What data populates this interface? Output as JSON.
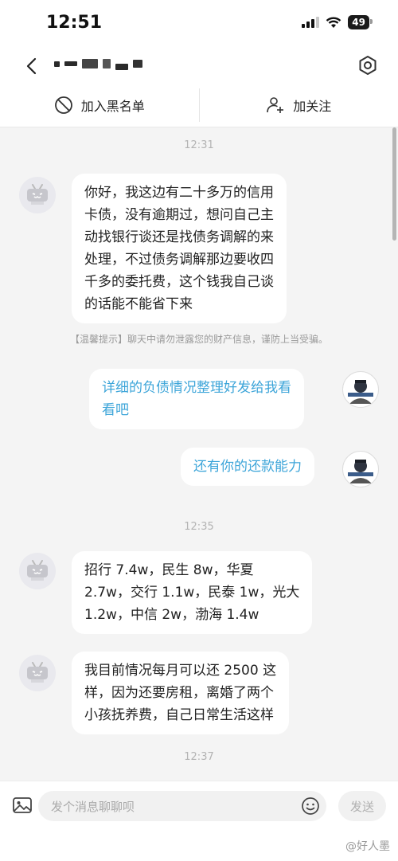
{
  "status": {
    "time": "12:51",
    "battery": "49"
  },
  "header": {
    "add_blacklist": "加入黑名单",
    "follow": "加关注"
  },
  "messages": [
    {
      "timestamp": "12:31"
    },
    {
      "side": "left",
      "text": "你好，我这边有二十多万的信用\n卡债，没有逾期过，想问自己主\n动找银行谈还是找债务调解的来\n处理，不过债务调解那边要收四\n千多的委托费，这个钱我自己谈\n的话能不能省下来"
    },
    {
      "tip": "【温馨提示】聊天中请勿泄露您的财产信息，谨防上当受骗。"
    },
    {
      "side": "right",
      "text": "详细的负债情况整理好发给我看\n看吧"
    },
    {
      "side": "right",
      "text": "还有你的还款能力"
    },
    {
      "timestamp": "12:35"
    },
    {
      "side": "left",
      "text": "招行 7.4w，民生 8w，华夏\n2.7w，交行 1.1w，民泰 1w，光大\n1.2w，中信 2w，渤海 1.4w"
    },
    {
      "side": "left",
      "text": "我目前情况每月可以还 2500 这\n样，因为还要房租，离婚了两个\n小孩抚养费，自己日常生活这样"
    },
    {
      "timestamp": "12:37"
    }
  ],
  "input": {
    "placeholder": "发个消息聊聊呗",
    "send": "发送"
  },
  "watermark": "@好人墨"
}
